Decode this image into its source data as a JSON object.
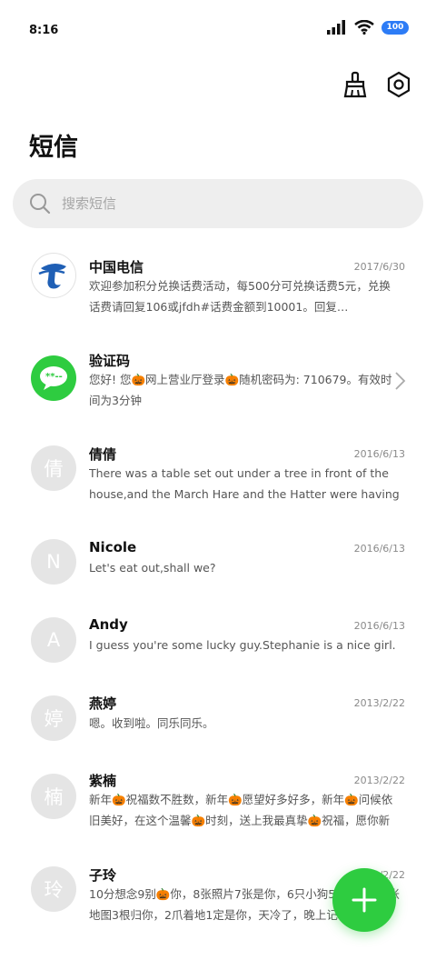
{
  "status_bar": {
    "time": "8:16",
    "battery": "100",
    "icons": [
      "signal-icon",
      "wifi-icon",
      "battery-icon"
    ]
  },
  "toolbar": {
    "icons": [
      "broom-icon",
      "settings-icon"
    ]
  },
  "title": "短信",
  "search": {
    "placeholder": "搜索短信"
  },
  "colors": {
    "fab": "#2ecc40",
    "battery": "#2d7cf6",
    "verify_avatar": "#2ecc40"
  },
  "messages": [
    {
      "name": "中国电信",
      "date": "2017/6/30",
      "avatar": "",
      "preview": "欢迎参加积分兑换话费活动，每500分可兑换话费5元，兑换话费请回复106或jfdh#话费金额到10001。回复…"
    },
    {
      "name": "验证码",
      "date": "",
      "avatar": "",
      "preview": "您好! 您🎃网上营业厅登录🎃随机密码为: 710679。有效时间为3分钟"
    },
    {
      "name": "倩倩",
      "date": "2016/6/13",
      "avatar": "倩",
      "preview": "There was a table set out under a tree in front of the house,and the March Hare and the Hatter were having t…"
    },
    {
      "name": "Nicole",
      "date": "2016/6/13",
      "avatar": "N",
      "preview": "Let's eat out,shall we?"
    },
    {
      "name": "Andy",
      "date": "2016/6/13",
      "avatar": "A",
      "preview": "I guess you're some lucky guy.Stephanie is a nice girl."
    },
    {
      "name": "燕婷",
      "date": "2013/2/22",
      "avatar": "婷",
      "preview": "嗯。收到啦。同乐同乐。"
    },
    {
      "name": "紫楠",
      "date": "2013/2/22",
      "avatar": "楠",
      "preview": "新年🎃祝福数不胜数，新年🎃愿望好多好多，新年🎃问候依旧美好，在这个温馨🎃时刻，送上我最真挚🎃祝福，愿你新年健康…"
    },
    {
      "name": "子玲",
      "date": "2013/2/22",
      "avatar": "玲",
      "preview": "10分想念9别🎃你，8张照片7张是你，6只小狗5只像你，4张地图3根归你，2爪着地1定是你，天冷了，晚上记得盖好被子…"
    }
  ]
}
